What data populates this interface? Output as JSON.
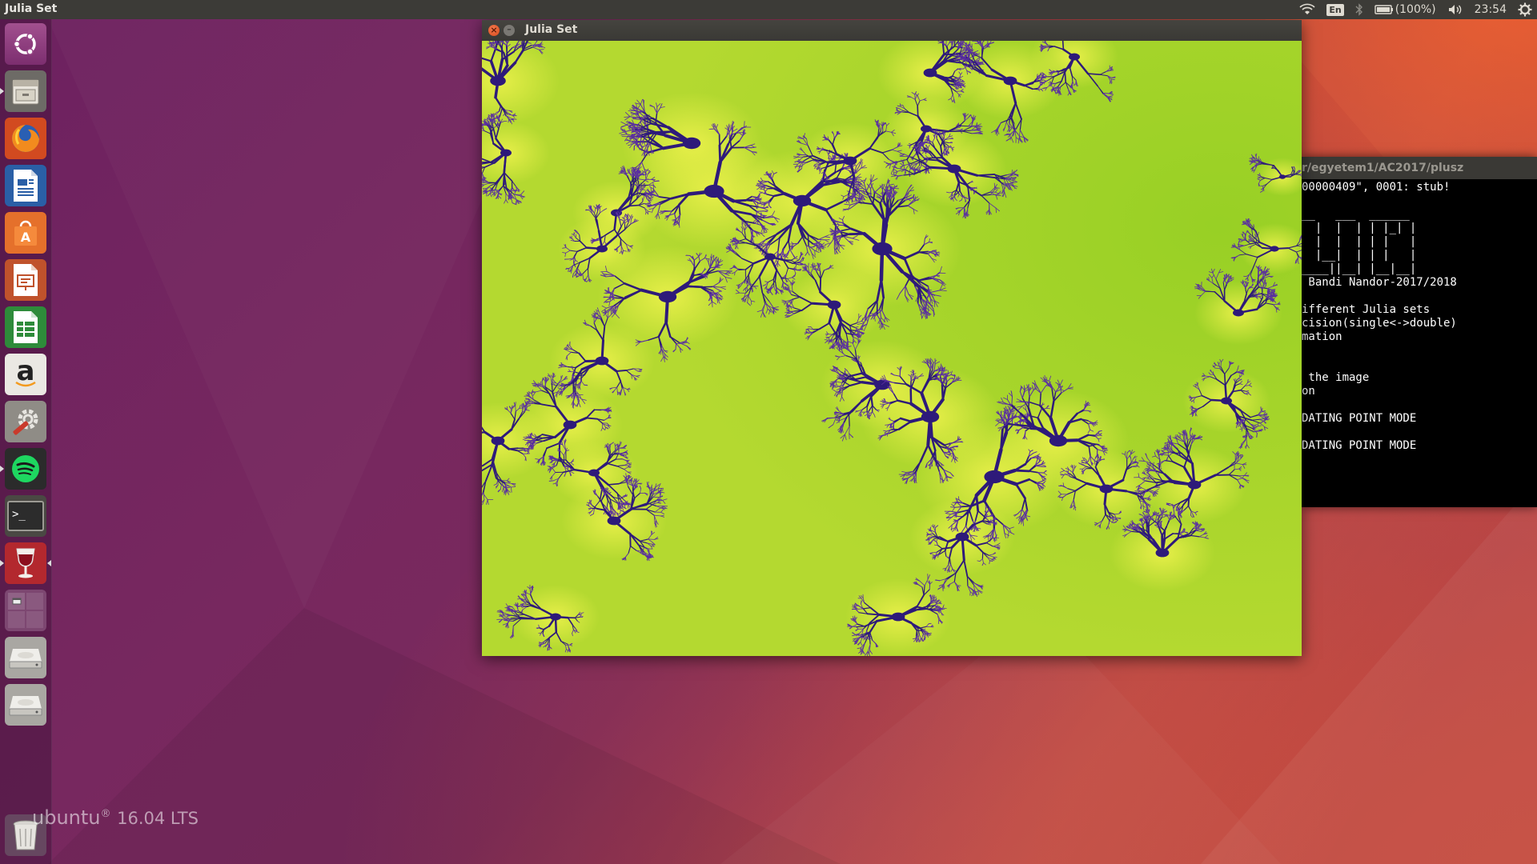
{
  "top_panel": {
    "app_title": "Julia Set",
    "language": "En",
    "battery": "(100%)",
    "clock": "23:54"
  },
  "launcher": {
    "items": [
      {
        "name": "dash-home",
        "icon": "ubuntu-logo-icon"
      },
      {
        "name": "files",
        "icon": "file-cabinet-icon"
      },
      {
        "name": "firefox",
        "icon": "firefox-icon"
      },
      {
        "name": "libreoffice-writer",
        "icon": "writer-document-icon"
      },
      {
        "name": "ubuntu-software",
        "icon": "software-bag-icon"
      },
      {
        "name": "libreoffice-impress",
        "icon": "impress-presentation-icon"
      },
      {
        "name": "libreoffice-calc",
        "icon": "calc-spreadsheet-icon"
      },
      {
        "name": "amazon",
        "icon": "amazon-icon",
        "label": "a"
      },
      {
        "name": "system-settings",
        "icon": "settings-tools-icon"
      },
      {
        "name": "spotify",
        "icon": "spotify-icon"
      },
      {
        "name": "terminal",
        "icon": "terminal-icon",
        "label": ">_"
      },
      {
        "name": "wine",
        "icon": "wine-glass-icon"
      },
      {
        "name": "workspace-switcher",
        "icon": "workspace-switcher-icon"
      },
      {
        "name": "drive-1",
        "icon": "hard-drive-icon"
      },
      {
        "name": "drive-2",
        "icon": "hard-drive-icon"
      },
      {
        "name": "trash",
        "icon": "trash-icon"
      }
    ]
  },
  "watermark": {
    "brand": "ubuntu",
    "registered": "®",
    "version": "16.04 LTS"
  },
  "julia_window": {
    "title": "Julia Set",
    "fractal_colors": {
      "background": "#b4d930",
      "halo": "#eaf04a",
      "set": "#2e1a7a",
      "set_edge": "#5a2fa0"
    }
  },
  "terminal": {
    "title": "r/egyetem1/AC2017/plusz",
    "lines": [
      "00000409\", 0001: stub!",
      "",
      "__   ___  ______",
      "  |  |  | | |_| |",
      "  |  |  | | |   |",
      "  |__|  | | |   |",
      "____||__| |__|__|",
      " Bandi Nandor-2017/2018",
      "",
      "ifferent Julia sets",
      "cision(single<->double)",
      "mation",
      "",
      "",
      " the image",
      "on",
      "",
      "DATING POINT MODE",
      "",
      "DATING POINT MODE"
    ]
  }
}
